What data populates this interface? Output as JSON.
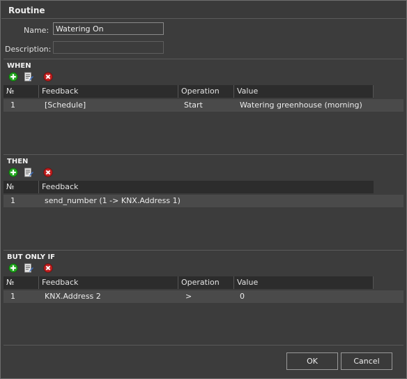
{
  "window": {
    "title": "Routine"
  },
  "form": {
    "name_label": "Name:",
    "name_value": "Watering On",
    "description_label": "Description:",
    "description_value": ""
  },
  "icons": {
    "add": "add-icon",
    "edit": "edit-list-icon",
    "delete": "delete-icon"
  },
  "colors": {
    "add": "#22a61f",
    "delete": "#c21f1f",
    "row_selected": "#4a4a4a",
    "header": "#2c2c2c"
  },
  "when": {
    "heading": "WHEN",
    "columns": [
      "№",
      "Feedback",
      "Operation",
      "Value"
    ],
    "rows": [
      {
        "num": "1",
        "feedback": "[Schedule]",
        "operation": "Start",
        "value": "Watering greenhouse (morning)"
      }
    ]
  },
  "then": {
    "heading": "THEN",
    "columns": [
      "№",
      "Feedback"
    ],
    "rows": [
      {
        "num": "1",
        "feedback": "send_number (1 -> KNX.Address 1)"
      }
    ]
  },
  "onlyif": {
    "heading": "BUT ONLY IF",
    "columns": [
      "№",
      "Feedback",
      "Operation",
      "Value"
    ],
    "rows": [
      {
        "num": "1",
        "feedback": "KNX.Address 2",
        "operation": ">",
        "value": "0"
      }
    ]
  },
  "buttons": {
    "ok": "OK",
    "cancel": "Cancel"
  }
}
